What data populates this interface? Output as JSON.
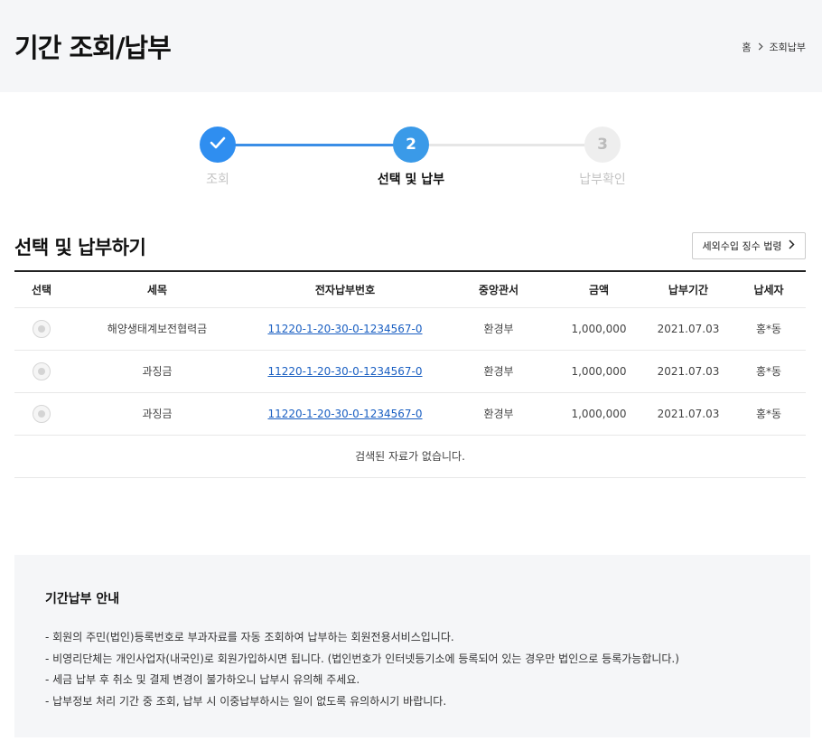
{
  "header": {
    "title": "기간 조회/납부"
  },
  "breadcrumb": {
    "home": "홈",
    "current": "조회납부"
  },
  "steps": [
    {
      "number": "1",
      "label": "조회",
      "state": "done"
    },
    {
      "number": "2",
      "label": "선택 및 납부",
      "state": "active"
    },
    {
      "number": "3",
      "label": "납부확인",
      "state": "pending"
    }
  ],
  "section": {
    "title": "선택 및 납부하기",
    "law_button_label": "세외수입 징수 법령"
  },
  "table": {
    "headers": [
      "선택",
      "세목",
      "전자납부번호",
      "중앙관서",
      "금액",
      "납부기간",
      "납세자"
    ],
    "rows": [
      {
        "tax_item": "해양생태계보전협력금",
        "payment_number": "11220-1-20-30-0-1234567-0",
        "agency": "환경부",
        "amount": "1,000,000",
        "period": "2021.07.03",
        "taxpayer": "홍*동"
      },
      {
        "tax_item": "과징금",
        "payment_number": "11220-1-20-30-0-1234567-0",
        "agency": "환경부",
        "amount": "1,000,000",
        "period": "2021.07.03",
        "taxpayer": "홍*동"
      },
      {
        "tax_item": "과징금",
        "payment_number": "11220-1-20-30-0-1234567-0",
        "agency": "환경부",
        "amount": "1,000,000",
        "period": "2021.07.03",
        "taxpayer": "홍*동"
      }
    ],
    "empty_message": "검색된 자료가 없습니다."
  },
  "notice": {
    "title": "기간납부 안내",
    "items": [
      "- 회원의 주민(법인)등록번호로 부과자료를 자동 조회하여 납부하는 회원전용서비스입니다.",
      "- 비영리단체는 개인사업자(내국인)로 회원가입하시면 됩니다. (법인번호가 인터넷등기소에 등록되어 있는 경우만 법인으로 등록가능합니다.)",
      "- 세금 납부 후 취소 및 결제 변경이 불가하오니 납부시 유의해 주세요.",
      "- 납부정보 처리 기간 중 조회, 납부 시 이중납부하시는 일이 없도록 유의하시기 바랍니다."
    ]
  },
  "colors": {
    "accent": "#2f8ef0",
    "link": "#1a5fc2",
    "panel_bg": "#f5f6f8"
  },
  "icons": {
    "done_step": "check-icon",
    "breadcrumb_separator": "chevron-right-icon",
    "law_button": "chevron-right-icon"
  }
}
